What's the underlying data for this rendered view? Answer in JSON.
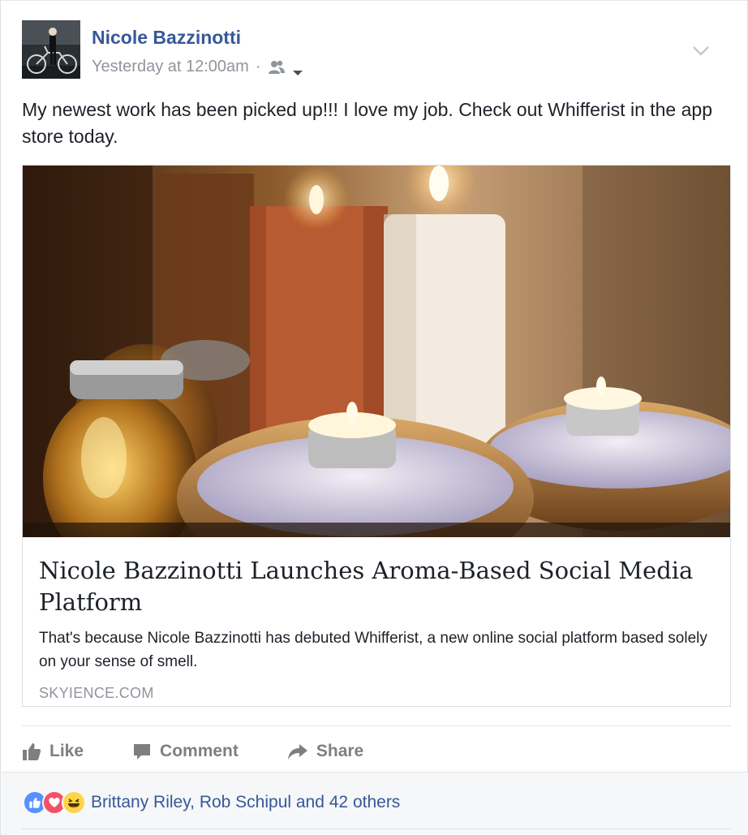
{
  "post": {
    "author": "Nicole Bazzinotti",
    "timestamp": "Yesterday at 12:00am",
    "separator": "·",
    "audience_icon": "friends-icon",
    "text": "My newest work has been picked up!!! I love my job. Check out Whifferist in the app store today."
  },
  "link": {
    "title": "Nicole Bazzinotti Launches Aroma-Based Social Media Platform",
    "description": "That's because Nicole Bazzinotti has debuted Whifferist, a new online social platform based solely on your sense of smell.",
    "domain": "SKYIENCE.COM"
  },
  "actions": {
    "like_label": "Like",
    "comment_label": "Comment",
    "share_label": "Share"
  },
  "reactions": {
    "types": [
      "like",
      "love",
      "haha"
    ],
    "summary": "Brittany Riley, Rob Schipul and 42 others"
  },
  "colors": {
    "name_link": "#365899",
    "meta": "#90949c",
    "like_blue": "#5890ff",
    "love_red": "#f25268",
    "haha_yellow": "#ffd44b"
  }
}
